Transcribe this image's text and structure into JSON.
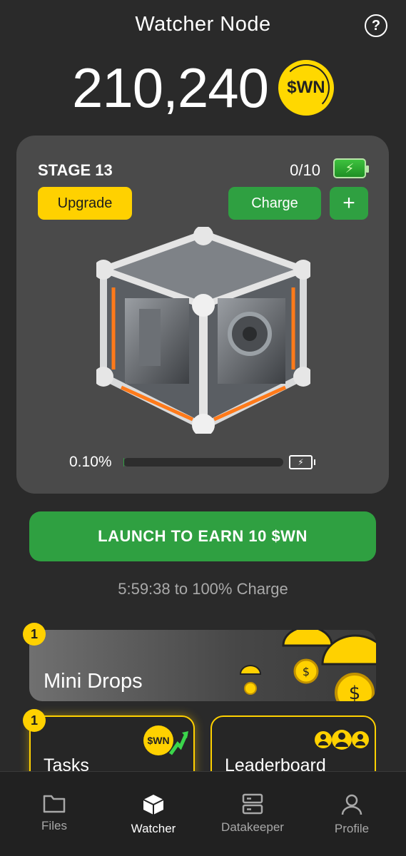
{
  "header": {
    "title": "Watcher Node",
    "help_icon": "help-circle-icon"
  },
  "balance": {
    "amount": "210,240",
    "coin_label": "$WN"
  },
  "stage_card": {
    "stage": "STAGE 13",
    "charge_count": "0/10",
    "battery_icon": "battery-charging-icon",
    "upgrade_label": "Upgrade",
    "charge_label": "Charge",
    "plus_label": "+",
    "node_image": "cube-machine-image",
    "progress_text": "0.10%",
    "progress_fraction": 0.001,
    "accent_color": "#ff7a1a"
  },
  "launch": {
    "label": "LAUNCH TO EARN 10 $WN"
  },
  "timer": {
    "text": "5:59:38 to 100% Charge"
  },
  "mini_drops": {
    "label": "Mini Drops",
    "badge": "1"
  },
  "tasks": {
    "label": "Tasks",
    "badge": "1",
    "coin_label": "$WN"
  },
  "leaderboard": {
    "label": "Leaderboard"
  },
  "nav": {
    "items": [
      {
        "label": "Files",
        "icon": "folder-icon"
      },
      {
        "label": "Watcher",
        "icon": "cube-icon"
      },
      {
        "label": "Datakeeper",
        "icon": "server-icon"
      },
      {
        "label": "Profile",
        "icon": "user-icon"
      }
    ]
  },
  "colors": {
    "yellow": "#ffd100",
    "green": "#2fa041",
    "background": "#2a2a2a",
    "card": "#4a4a4a"
  }
}
